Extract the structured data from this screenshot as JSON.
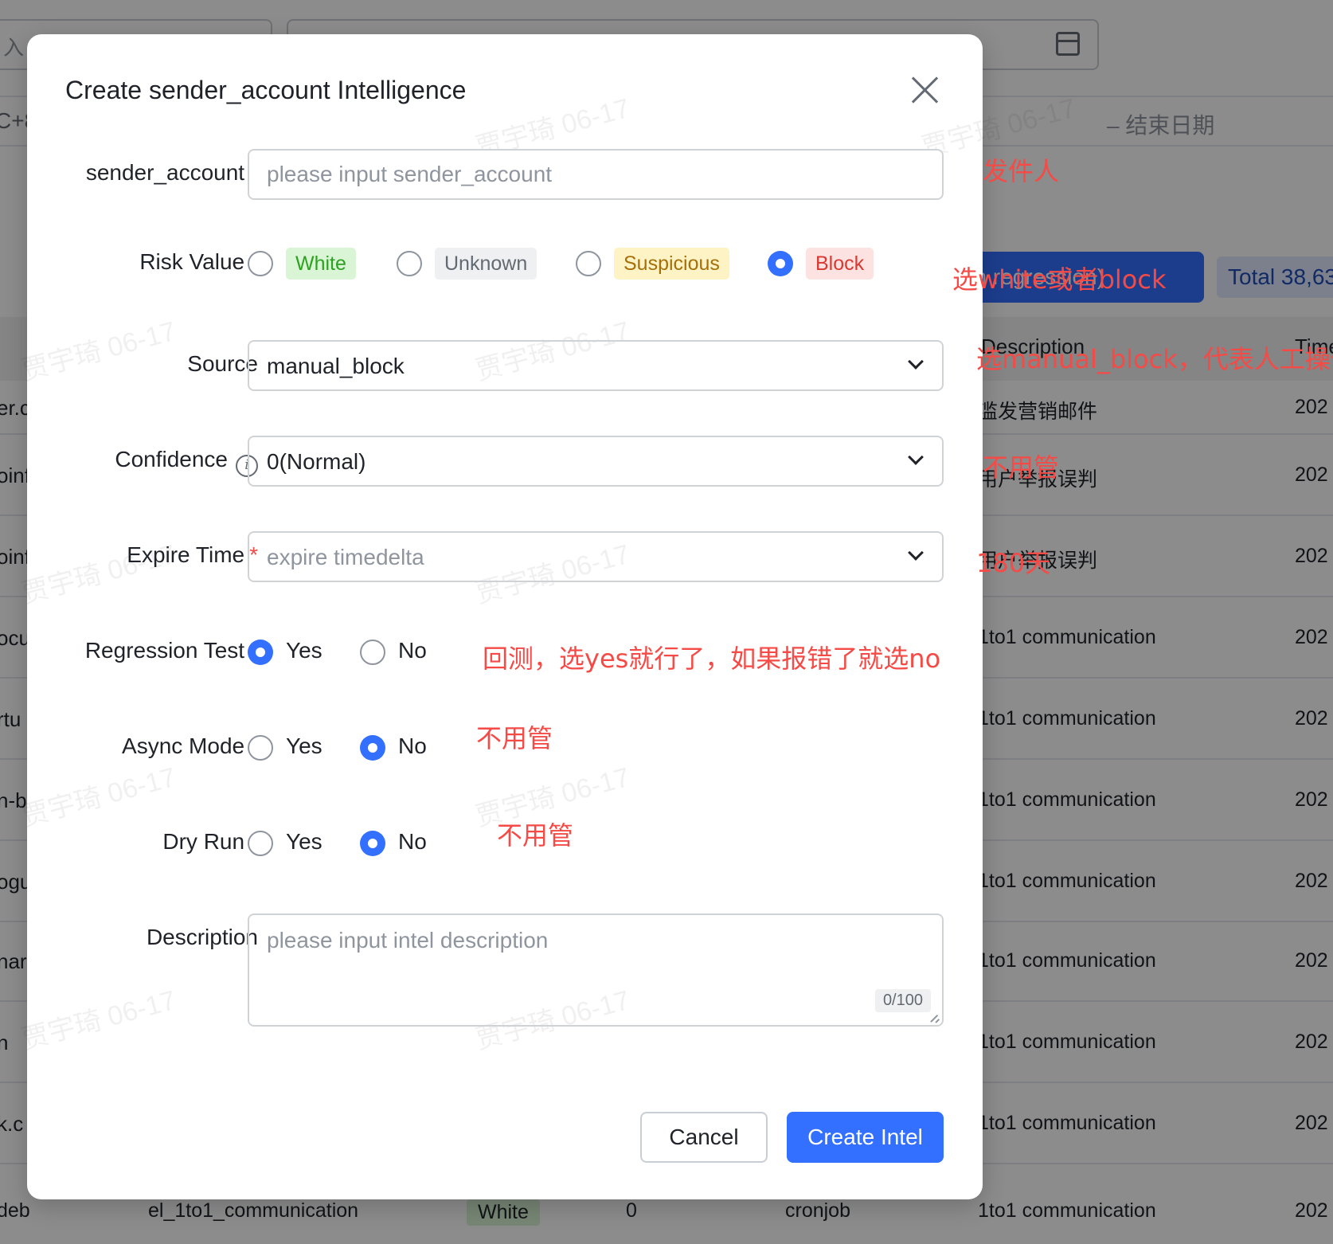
{
  "background": {
    "search_fragment": "入",
    "left_fragment": "C+8",
    "end_date_placeholder": "– 结束日期",
    "regression_button": "(with regression)",
    "total_badge": "Total 38,63",
    "table_header": {
      "description": "Description",
      "time": "Time"
    },
    "rows": [
      {
        "left": "er.c",
        "description": "滥发营销邮件",
        "time": "202"
      },
      {
        "left": "oinf",
        "description": "用户举报误判",
        "time": "202"
      },
      {
        "left": "oinf",
        "description": "用户举报误判",
        "time": "202"
      },
      {
        "left": "ocu",
        "description": "1to1 communication",
        "time": "202"
      },
      {
        "left": "rtu",
        "description": "1to1 communication",
        "time": "202"
      },
      {
        "left": "n-b",
        "description": "1to1 communication",
        "time": "202"
      },
      {
        "left": "ogu",
        "description": "1to1 communication",
        "time": "202"
      },
      {
        "left": "nart",
        "description": "1to1 communication",
        "time": "202"
      },
      {
        "left": "n",
        "description": "1to1 communication",
        "time": "202"
      },
      {
        "left": "k.c",
        "description": "1to1 communication",
        "time": "202"
      }
    ],
    "last_row": {
      "left": "deb",
      "name": "el_1to1_communication",
      "risk": "White",
      "confidence": "0",
      "source": "cronjob",
      "description": "1to1 communication",
      "time": "202"
    }
  },
  "modal": {
    "title": "Create sender_account Intelligence",
    "fields": {
      "sender_account": {
        "label": "sender_account",
        "placeholder": "please input sender_account",
        "value": ""
      },
      "risk_value": {
        "label": "Risk Value",
        "options": [
          {
            "label": "White",
            "checked": false
          },
          {
            "label": "Unknown",
            "checked": false
          },
          {
            "label": "Suspicious",
            "checked": false
          },
          {
            "label": "Block",
            "checked": true
          }
        ]
      },
      "source": {
        "label": "Source",
        "value": "manual_block"
      },
      "confidence": {
        "label": "Confidence",
        "value": "0(Normal)"
      },
      "expire_time": {
        "label": "Expire Time",
        "placeholder": "expire timedelta"
      },
      "regression_test": {
        "label": "Regression Test",
        "yes": "Yes",
        "no": "No",
        "selected": "Yes"
      },
      "async_mode": {
        "label": "Async Mode",
        "yes": "Yes",
        "no": "No",
        "selected": "No"
      },
      "dry_run": {
        "label": "Dry Run",
        "yes": "Yes",
        "no": "No",
        "selected": "No"
      },
      "description": {
        "label": "Description",
        "placeholder": "please input intel description",
        "counter": "0/100"
      }
    },
    "required_mark": "*",
    "buttons": {
      "cancel": "Cancel",
      "create": "Create Intel"
    }
  },
  "annotations": {
    "sender": "发件人",
    "risk": "选white或者block",
    "source": "选manual_block，代表人工操作",
    "confidence": "不用管",
    "expire": "180天",
    "regression": "回测，选yes就行了，如果报错了就选no",
    "async": "不用管",
    "dry_run": "不用管"
  },
  "watermark": "贾宇琦 06-17",
  "colors": {
    "primary": "#3370ff",
    "required": "#f54a45",
    "annotation": "#f54a45"
  }
}
